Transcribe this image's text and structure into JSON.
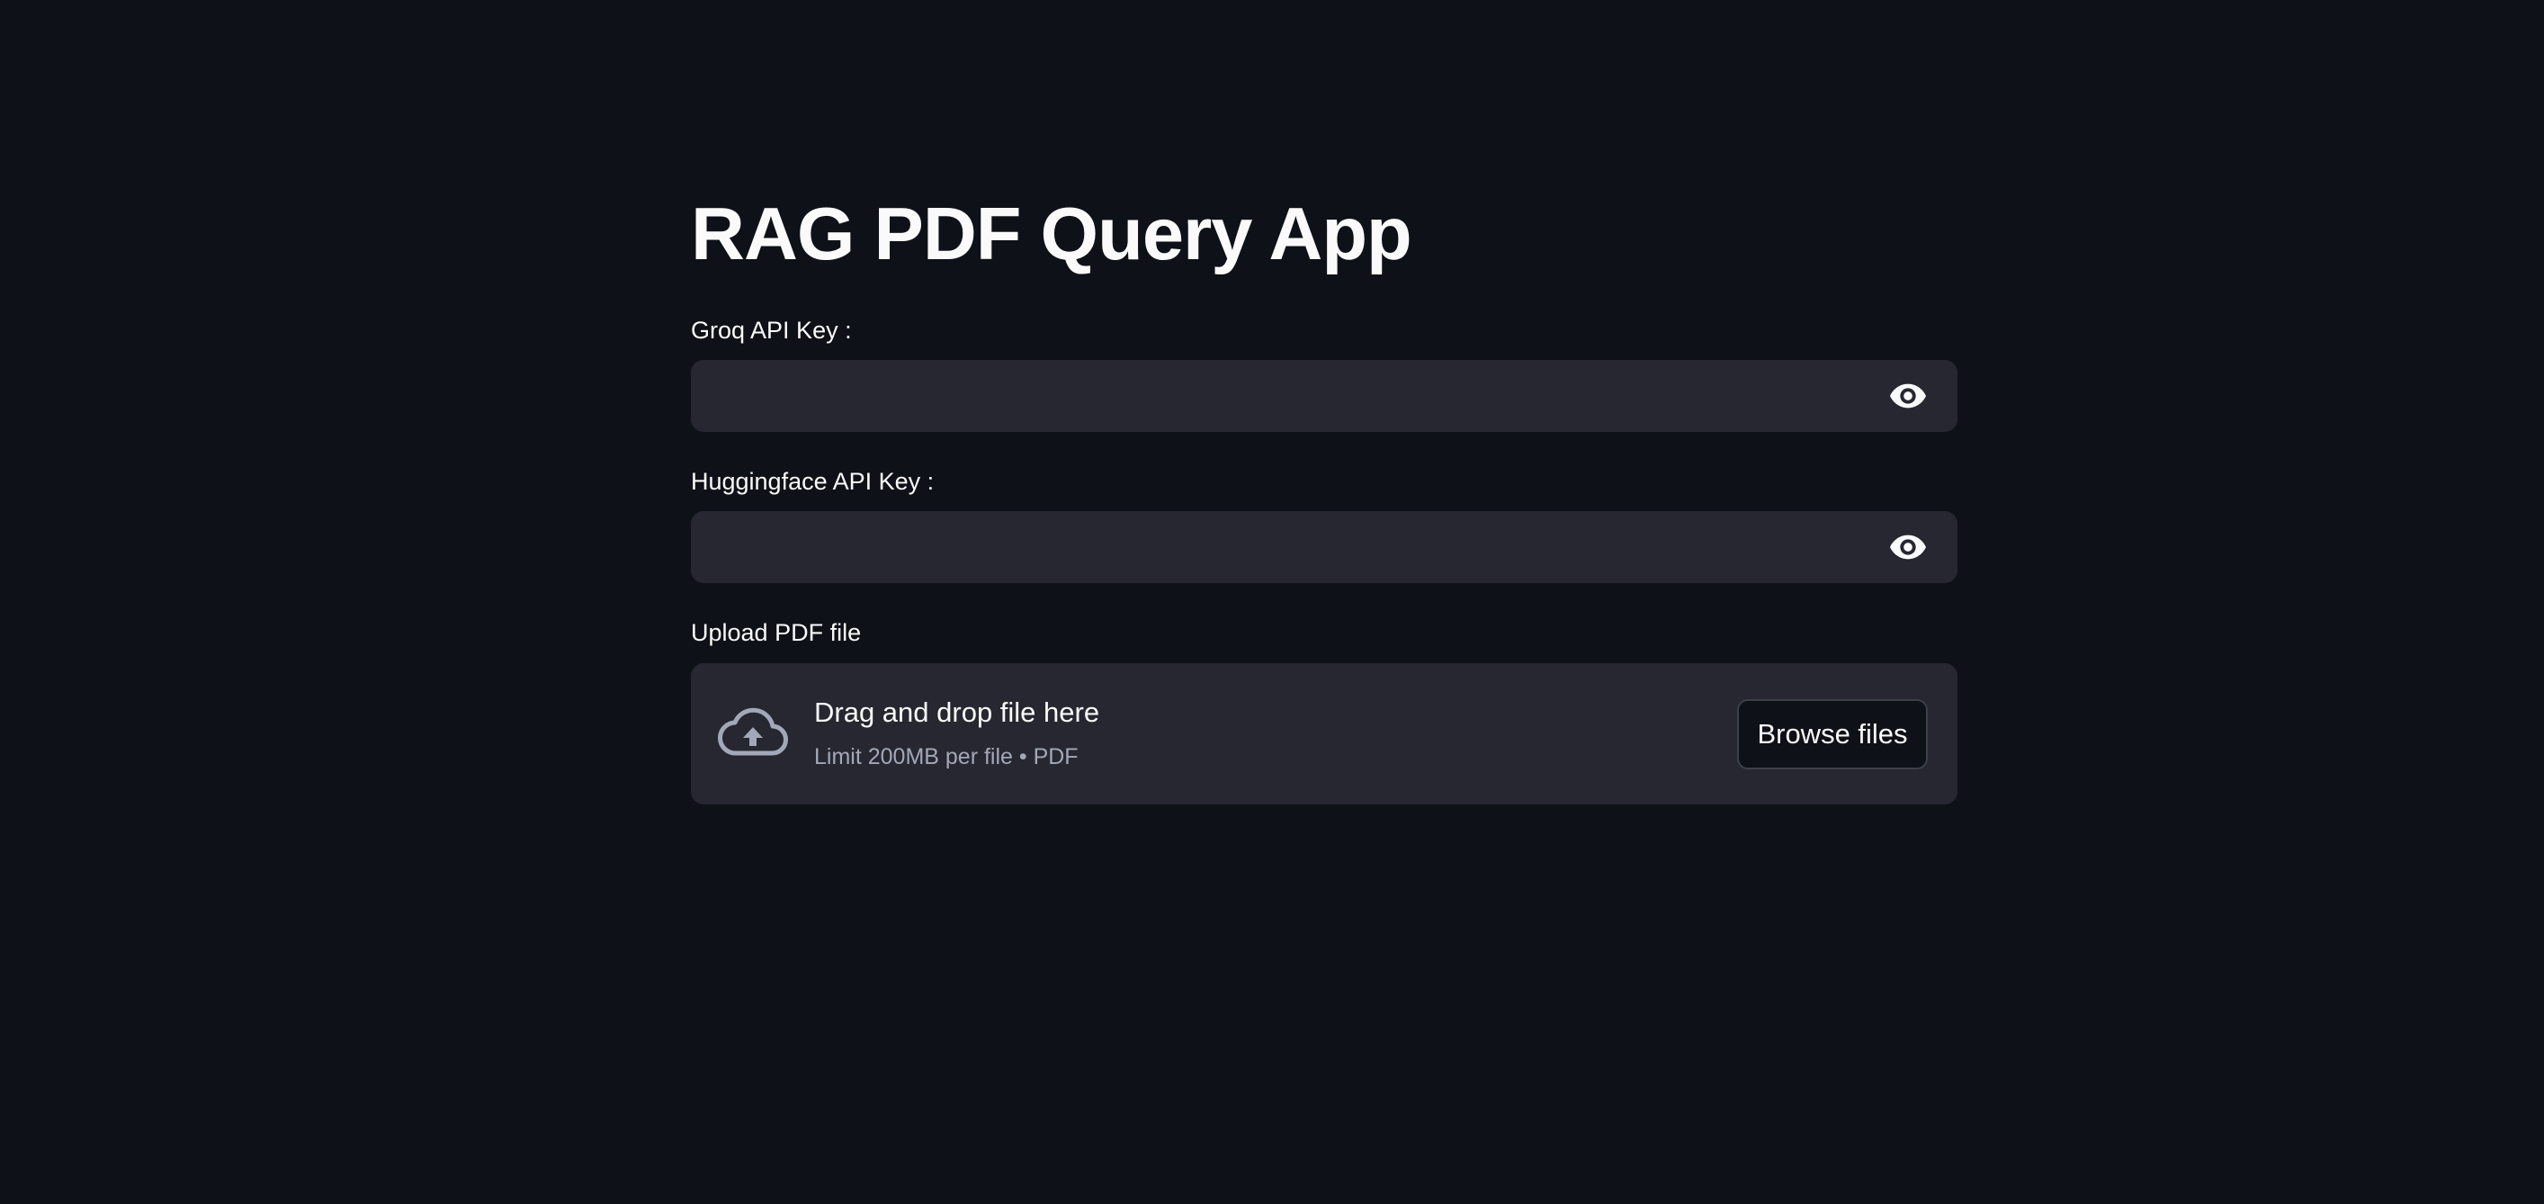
{
  "app": {
    "title": "RAG PDF Query App"
  },
  "groq_field": {
    "label": "Groq API Key :",
    "value": "",
    "placeholder": "",
    "toggle_icon": "eye-icon"
  },
  "hf_field": {
    "label": "Huggingface API Key :",
    "value": "",
    "placeholder": "",
    "toggle_icon": "eye-icon"
  },
  "uploader": {
    "label": "Upload PDF file",
    "drop_text": "Drag and drop file here",
    "limit_text": "Limit 200MB per file • PDF",
    "button_label": "Browse files",
    "icon": "cloud-upload-icon"
  },
  "colors": {
    "background": "#0e1117",
    "input_background": "#262730",
    "text": "#fafafa",
    "muted_text": "#a3a8b8",
    "button_border": "#3d404a"
  }
}
